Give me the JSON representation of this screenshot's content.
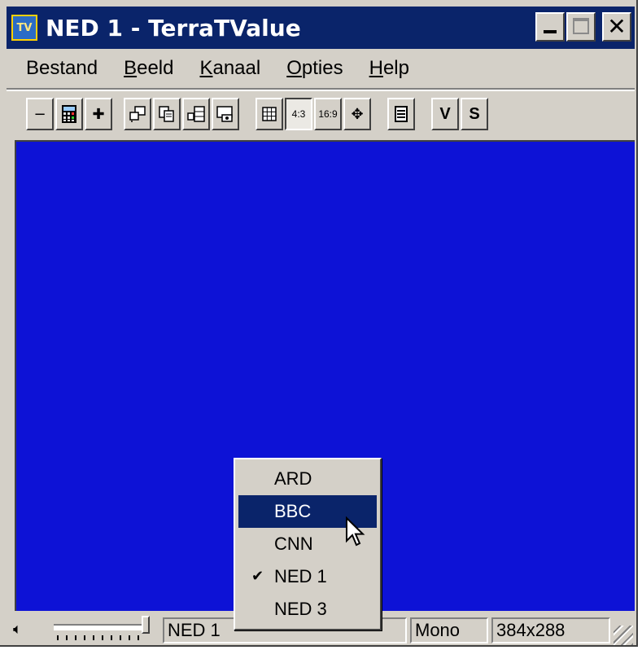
{
  "window": {
    "title": "NED 1 - TerraTValue",
    "app_icon_text": "TV"
  },
  "title_buttons": {
    "close_glyph": "✕"
  },
  "menubar": {
    "items": [
      {
        "pre": "",
        "u": "",
        "rest": "Bestand"
      },
      {
        "pre": "",
        "u": "B",
        "rest": "eeld"
      },
      {
        "pre": "",
        "u": "K",
        "rest": "anaal"
      },
      {
        "pre": "",
        "u": "O",
        "rest": "pties"
      },
      {
        "pre": "",
        "u": "H",
        "rest": "elp"
      }
    ]
  },
  "toolbar": {
    "minus": "−",
    "plus": "✚",
    "ratio_43": "4:3",
    "ratio_169": "16:9",
    "move": "✥",
    "v": "V",
    "s": "S"
  },
  "statusbar": {
    "channel": "NED 1",
    "audio": "Mono",
    "resolution": "384x288"
  },
  "channel_menu": {
    "items": [
      {
        "label": "ARD",
        "checked": false,
        "selected": false
      },
      {
        "label": "BBC",
        "checked": false,
        "selected": true
      },
      {
        "label": "CNN",
        "checked": false,
        "selected": false
      },
      {
        "label": "NED 1",
        "checked": true,
        "selected": false
      },
      {
        "label": "NED 3",
        "checked": false,
        "selected": false
      }
    ],
    "check_glyph": "✔"
  },
  "colors": {
    "titlebar": "#0a246a",
    "video_background": "#0d12d6",
    "menu_highlight": "#0a246a",
    "face": "#d4d0c8"
  }
}
